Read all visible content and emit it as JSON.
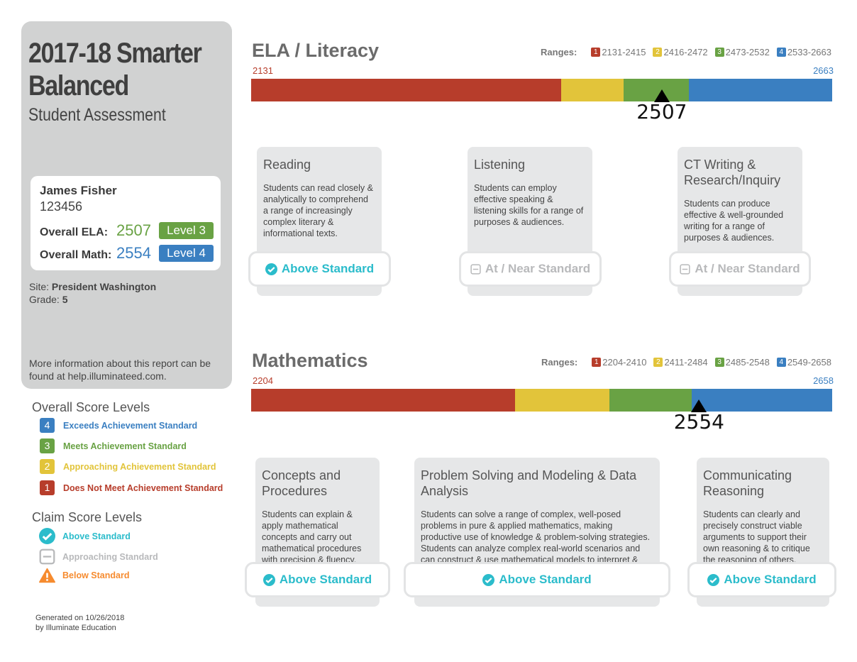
{
  "header": {
    "title_line1": "2017-18 Smarter",
    "title_line2": "Balanced",
    "subtitle": "Student Assessment"
  },
  "student": {
    "name": "James Fisher",
    "id": "123456",
    "ela_label": "Overall ELA:",
    "ela_score": "2507",
    "ela_level": "Level 3",
    "math_label": "Overall Math:",
    "math_score": "2554",
    "math_level": "Level 4",
    "site_label": "Site:",
    "site": "President Washington",
    "grade_label": "Grade:",
    "grade": "5"
  },
  "info": "More information about this report can be found at help.illuminateed.com.",
  "legend": {
    "overall_title": "Overall Score Levels",
    "overall": [
      {
        "n": "4",
        "label": "Exceeds Achievement Standard",
        "color": "#3a7fc1"
      },
      {
        "n": "3",
        "label": "Meets Achievement Standard",
        "color": "#69a244"
      },
      {
        "n": "2",
        "label": "Approaching Achievement Standard",
        "color": "#e2c43a"
      },
      {
        "n": "1",
        "label": "Does Not Meet Achievement Standard",
        "color": "#b73d2b"
      }
    ],
    "claim_title": "Claim Score Levels",
    "claim": [
      {
        "label": "Above Standard",
        "icon": "check-circle-icon",
        "color": "#2bbccb"
      },
      {
        "label": "Approaching Standard",
        "icon": "minus-square-icon",
        "color": "#b8b9bb"
      },
      {
        "label": "Below Standard",
        "icon": "warning-triangle-icon",
        "color": "#f68b2f"
      }
    ]
  },
  "footer": {
    "line1": "Generated on 10/26/2018",
    "line2": "by Illuminate Education"
  },
  "ranges_label": "Ranges:",
  "ela": {
    "title": "ELA / Literacy",
    "min": "2131",
    "max": "2663",
    "score": "2507",
    "ranges": [
      {
        "n": "1",
        "text": "2131-2415",
        "lo": 2131,
        "hi": 2415,
        "color": "#b73d2b"
      },
      {
        "n": "2",
        "text": "2416-2472",
        "lo": 2415,
        "hi": 2472,
        "color": "#e2c43a"
      },
      {
        "n": "3",
        "text": "2473-2532",
        "lo": 2472,
        "hi": 2532,
        "color": "#69a244"
      },
      {
        "n": "4",
        "text": "2533-2663",
        "lo": 2532,
        "hi": 2663,
        "color": "#3a7fc1"
      }
    ],
    "claims": [
      {
        "title": "Reading",
        "desc": "Students can read closely & analytically to comprehend a range of increasingly complex literary & informational texts.",
        "status": "Above Standard"
      },
      {
        "title": "Listening",
        "desc": "Students can employ effective speaking & listening skills for a range of purposes & audiences.",
        "status": "At / Near Standard"
      },
      {
        "title": "CT Writing & Research/Inquiry",
        "desc": "Students can produce effective & well-grounded writing for a range of purposes & audiences.",
        "status": "At / Near Standard"
      }
    ]
  },
  "math": {
    "title": "Mathematics",
    "min": "2204",
    "max": "2658",
    "score": "2554",
    "ranges": [
      {
        "n": "1",
        "text": "2204-2410",
        "lo": 2204,
        "hi": 2410,
        "color": "#b73d2b"
      },
      {
        "n": "2",
        "text": "2411-2484",
        "lo": 2410,
        "hi": 2484,
        "color": "#e2c43a"
      },
      {
        "n": "3",
        "text": "2485-2548",
        "lo": 2484,
        "hi": 2548,
        "color": "#69a244"
      },
      {
        "n": "4",
        "text": "2549-2658",
        "lo": 2548,
        "hi": 2658,
        "color": "#3a7fc1"
      }
    ],
    "claims": [
      {
        "title": "Concepts and Procedures",
        "desc": "Students can explain & apply mathematical concepts and carry out mathematical procedures with precision & fluency.",
        "status": "Above Standard"
      },
      {
        "title": "Problem Solving and Modeling & Data Analysis",
        "desc": "Students can solve a range of complex, well-posed problems in pure & applied mathematics, making productive use of knowledge & problem-solving strategies. Students can analyze complex real-world scenarios and can construct & use mathematical models to interpret & solve problems.",
        "status": "Above Standard"
      },
      {
        "title": "Communicating Reasoning",
        "desc": "Students can clearly and precisely construct viable arguments to support their own reasoning & to critique the reasoning of others.",
        "status": "Above Standard"
      }
    ]
  }
}
